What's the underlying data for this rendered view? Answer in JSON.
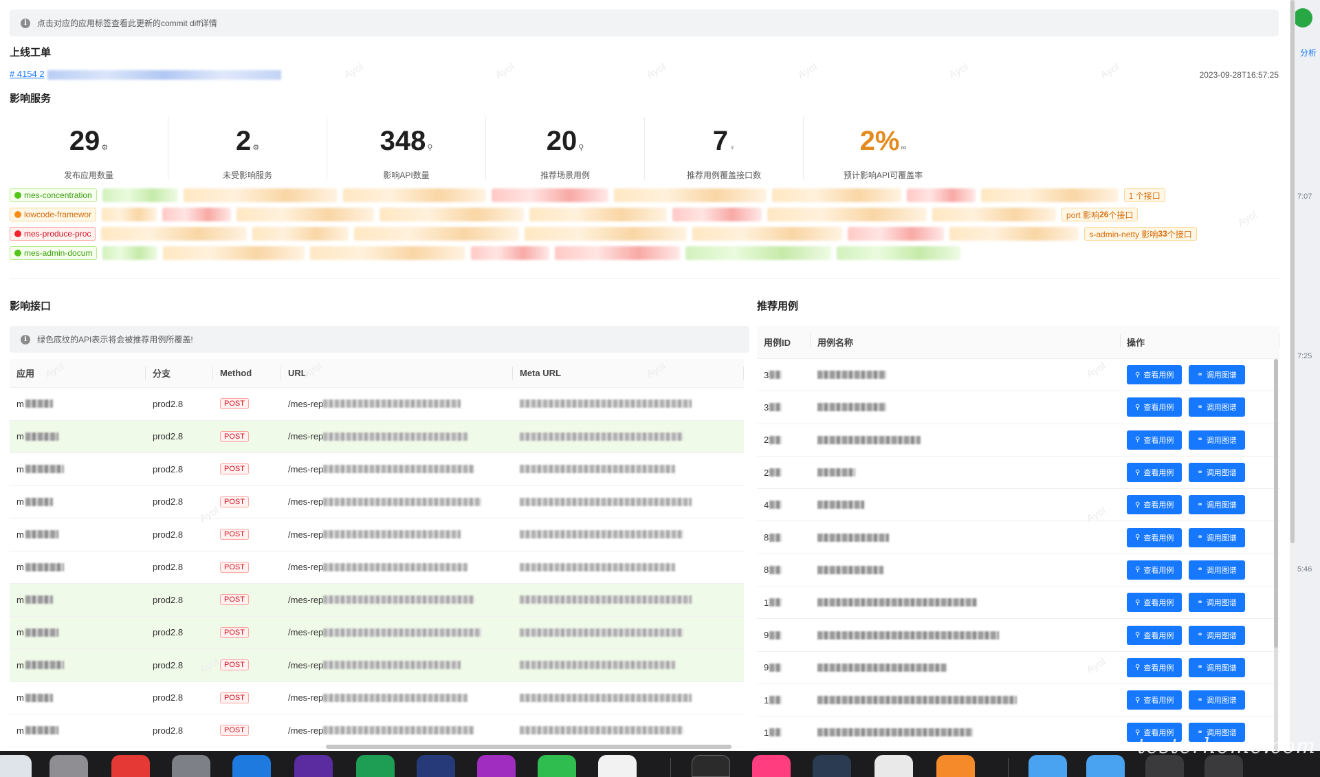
{
  "notice_top": "点击对应的应用标签查看此更新的commit diff详情",
  "order_section_title": "上线工单",
  "order_link": "# 4154 2",
  "order_time": "2023-09-28T16:57:25",
  "impact_section_title": "影响服务",
  "stats": [
    {
      "value": "29",
      "label": "发布应用数量",
      "icon": "gear-icon",
      "symbol": "⚙",
      "color": "#1f1f1f"
    },
    {
      "value": "2",
      "label": "未受影响服务",
      "icon": "gear-icon",
      "symbol": "⚙",
      "color": "#1f1f1f"
    },
    {
      "value": "348",
      "label": "影响API数量",
      "icon": "link-icon",
      "symbol": "⚲",
      "color": "#1f1f1f"
    },
    {
      "value": "20",
      "label": "推荐场景用例",
      "icon": "link-icon",
      "symbol": "⚲",
      "color": "#1f1f1f"
    },
    {
      "value": "7",
      "label": "推荐用例覆盖接口数",
      "icon": "pin-icon",
      "symbol": "♀",
      "color": "#1f1f1f"
    },
    {
      "value": "2%",
      "label": "预计影响API可覆盖率",
      "icon": "group-icon",
      "symbol": "∞",
      "color": "#e58a1f"
    }
  ],
  "service_tags": {
    "row1_first": "mes-concentration",
    "row1_tail": "1 个接口",
    "row2_first": "lowcode-framewor",
    "row2_tail_prefix": "port 影响 ",
    "row2_tail_count": "26",
    "row2_tail_suffix": " 个接口",
    "row3_first": "mes-produce-proc",
    "row3_tail_prefix": "s-admin-netty 影响 ",
    "row3_tail_count": "33",
    "row3_tail_suffix": " 个接口",
    "row4_first": "mes-admin-docum"
  },
  "api_section_title": "影响接口",
  "api_notice": "绿色底纹的API表示将会被推荐用例所覆盖!",
  "api_table": {
    "headers": [
      "应用",
      "分支",
      "Method",
      "URL",
      "Meta URL"
    ],
    "rows": [
      {
        "app": "m",
        "branch": "prod2.8",
        "method": "POST",
        "url": "/mes-rep",
        "highlight": false
      },
      {
        "app": "m",
        "branch": "prod2.8",
        "method": "POST",
        "url": "/mes-rep",
        "highlight": true
      },
      {
        "app": "m",
        "branch": "prod2.8",
        "method": "POST",
        "url": "/mes-rep",
        "highlight": false
      },
      {
        "app": "m",
        "branch": "prod2.8",
        "method": "POST",
        "url": "/mes-rep",
        "highlight": false
      },
      {
        "app": "m",
        "branch": "prod2.8",
        "method": "POST",
        "url": "/mes-rep",
        "highlight": false
      },
      {
        "app": "m",
        "branch": "prod2.8",
        "method": "POST",
        "url": "/mes-rep",
        "highlight": false
      },
      {
        "app": "m",
        "branch": "prod2.8",
        "method": "POST",
        "url": "/mes-rep",
        "highlight": true
      },
      {
        "app": "m",
        "branch": "prod2.8",
        "method": "POST",
        "url": "/mes-rep",
        "highlight": true
      },
      {
        "app": "m",
        "branch": "prod2.8",
        "method": "POST",
        "url": "/mes-rep",
        "highlight": true
      },
      {
        "app": "m",
        "branch": "prod2.8",
        "method": "POST",
        "url": "/mes-rep",
        "highlight": false
      },
      {
        "app": "m",
        "branch": "prod2.8",
        "method": "POST",
        "url": "/mes-rep",
        "highlight": false
      }
    ]
  },
  "case_section_title": "推荐用例",
  "case_table": {
    "headers": [
      "用例ID",
      "用例名称",
      "操作"
    ],
    "view_label": "查看用例",
    "graph_label": "调用图谱",
    "rows": [
      {
        "id": "3"
      },
      {
        "id": "3"
      },
      {
        "id": "2"
      },
      {
        "id": "2"
      },
      {
        "id": "4"
      },
      {
        "id": "8"
      },
      {
        "id": "8"
      },
      {
        "id": "1"
      },
      {
        "id": "9"
      },
      {
        "id": "9"
      },
      {
        "id": "1"
      },
      {
        "id": "1"
      }
    ]
  },
  "watermark_text": "Ayol",
  "brand_watermark": "testerhome.com",
  "bg_window": {
    "times": [
      "7:07",
      "7:25",
      "5:46"
    ],
    "link": "分析"
  },
  "colors": {
    "primary": "#1677ff",
    "highlight_row": "#f0fae9",
    "accent_orange": "#e58a1f"
  }
}
